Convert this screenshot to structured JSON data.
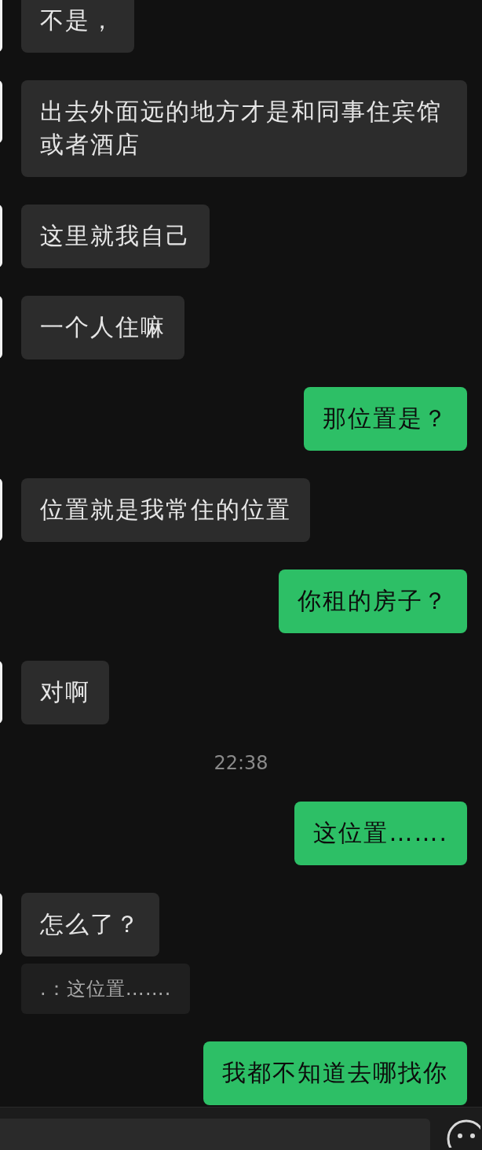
{
  "messages": [
    {
      "kind": "received",
      "text": "不是，"
    },
    {
      "kind": "received",
      "text": "出去外面远的地方才是和同事住宾馆或者酒店"
    },
    {
      "kind": "received",
      "text": "这里就我自己"
    },
    {
      "kind": "received",
      "text": "一个人住嘛"
    },
    {
      "kind": "sent",
      "text": "那位置是？"
    },
    {
      "kind": "received",
      "text": "位置就是我常住的位置"
    },
    {
      "kind": "sent",
      "text": "你租的房子？"
    },
    {
      "kind": "received",
      "text": "对啊"
    },
    {
      "kind": "time",
      "text": "22:38"
    },
    {
      "kind": "sent",
      "text": "这位置……."
    },
    {
      "kind": "received",
      "text": "怎么了？"
    },
    {
      "kind": "quote",
      "text": ".：这位置……."
    },
    {
      "kind": "sent",
      "text": "我都不知道去哪找你"
    }
  ]
}
